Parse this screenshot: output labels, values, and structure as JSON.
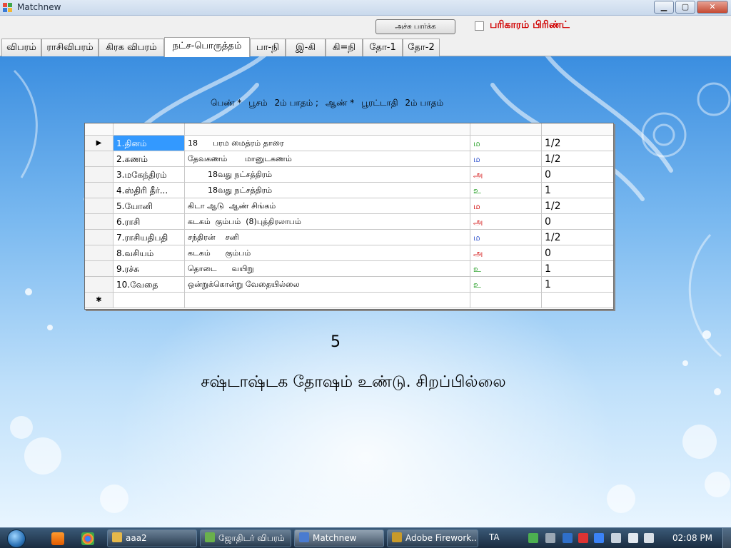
{
  "window": {
    "title": "Matchnew",
    "minimize_glyph": "▁",
    "maximize_glyph": "▢",
    "close_glyph": "✕"
  },
  "toolbar": {
    "print_label": "அச்சு பார்க்க",
    "remedy_label": "பரிகாரம் பிரிண்ட்",
    "remedy_checked": false,
    "remedy_color": "#d00000"
  },
  "tabs": [
    {
      "label": "விபரம்"
    },
    {
      "label": "ராசிவிபரம்"
    },
    {
      "label": "கிரக விபரம்"
    },
    {
      "label": "நட்ச-பொருத்தம்",
      "active": true
    },
    {
      "label": "பா-நி"
    },
    {
      "label": "இ-கி"
    },
    {
      "label": "கி=நி"
    },
    {
      "label": "தோ-1"
    },
    {
      "label": "தோ-2"
    }
  ],
  "match_header": {
    "bride_label": "பெண் *",
    "bride_star": "பூசம்",
    "bride_pada": "2ம் பாதம் ;",
    "groom_label": "ஆண் *",
    "groom_star": "பூரட்டாதி",
    "groom_pada": "2ம் பாதம்"
  },
  "grid": {
    "current_row_marker": "▶",
    "new_row_marker": "✱",
    "rows": [
      {
        "name": "1.தினம்",
        "detail": "18      பரம மைத்ரம் தாரை",
        "mark": "ம",
        "mark_color": "#1a9a1a",
        "points": "1/2"
      },
      {
        "name": "2.கணம்",
        "detail": "தேவகணம்       மானுடகணம்",
        "mark": "ம",
        "mark_color": "#1a40c8",
        "points": "1/2"
      },
      {
        "name": "3.மகேந்திரம்",
        "detail": "        18வது நட்சத்திரம்",
        "mark": "அ",
        "mark_color": "#d00000",
        "points": "0"
      },
      {
        "name": "4.ஸ்திரி தீர்...",
        "detail": "        18வது நட்சத்திரம்",
        "mark": "உ",
        "mark_color": "#1a9a1a",
        "points": "1"
      },
      {
        "name": "5.யோனி",
        "detail": "கிடா ஆடு  ஆண் சிங்கம்",
        "mark": "ம",
        "mark_color": "#d00000",
        "points": "1/2"
      },
      {
        "name": "6.ராசி",
        "detail": "கடகம்  கும்பம்  (8)புத்திரலாபம்",
        "mark": "அ",
        "mark_color": "#d00000",
        "points": "0"
      },
      {
        "name": "7.ராசியதிபதி",
        "detail": "சந்திரன்    சனி",
        "mark": "ம",
        "mark_color": "#1a40c8",
        "points": "1/2"
      },
      {
        "name": "8.வசியம்",
        "detail": "கடகம்      கும்பம்",
        "mark": "அ",
        "mark_color": "#d00000",
        "points": "0"
      },
      {
        "name": "9.ரச்சு",
        "detail": "தொடை      வயிறு",
        "mark": "உ",
        "mark_color": "#1a9a1a",
        "points": "1"
      },
      {
        "name": "10.வேதை",
        "detail": "ஒன்றுக்கொன்று வேதையில்லை",
        "mark": "உ",
        "mark_color": "#1a9a1a",
        "points": "1"
      }
    ]
  },
  "result": {
    "score": "5",
    "verdict": "சஷ்டாஷ்டக தோஷம் உண்டு. சிறப்பில்லை"
  },
  "taskbar": {
    "items": [
      {
        "label": "aaa2",
        "icon": "folder-icon",
        "color": "#e6b84a"
      },
      {
        "label": "ஜோதிடர் விபரம்",
        "icon": "app-icon",
        "color": "#6ab04c"
      },
      {
        "label": "Matchnew",
        "icon": "app-icon",
        "color": "#4a7bd0",
        "active": true
      },
      {
        "label": "Adobe Firework...",
        "icon": "fireworks-icon",
        "color": "#c89a2a"
      }
    ],
    "language": "TA",
    "clock": "02:08 PM"
  }
}
